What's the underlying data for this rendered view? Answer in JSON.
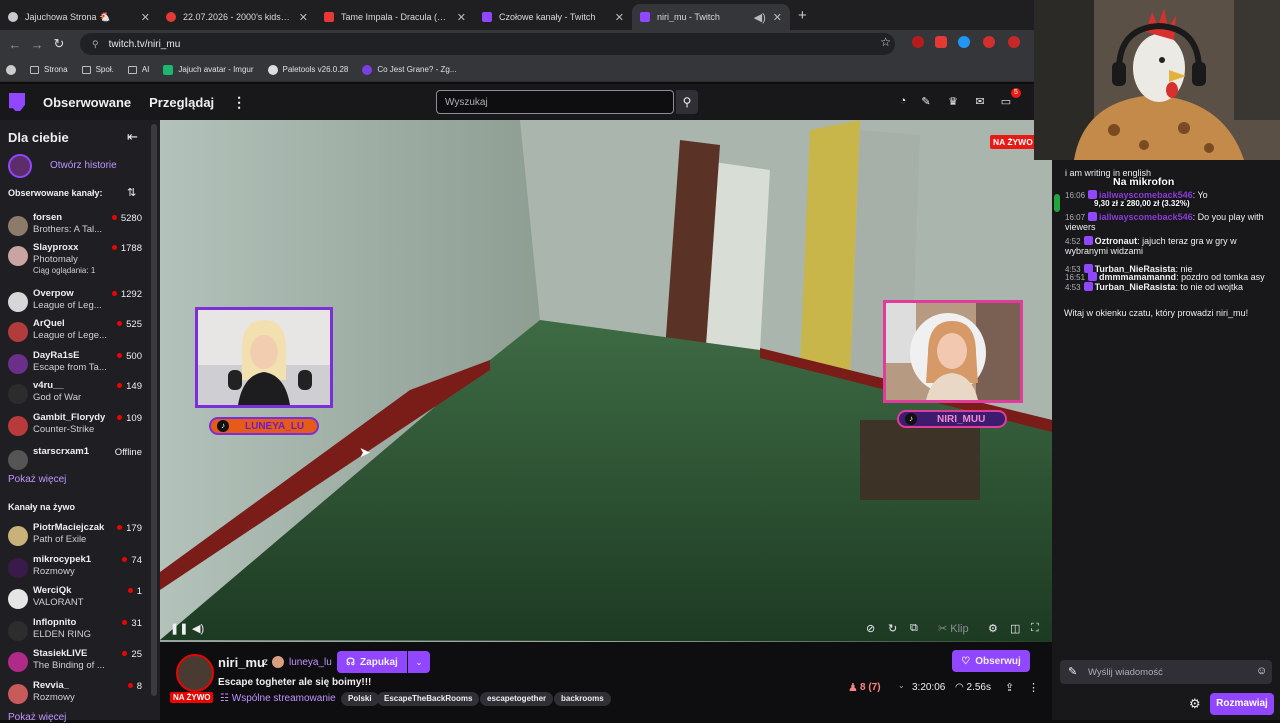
{
  "browser": {
    "tabs": [
      {
        "title": "Jajuchowa Strona 🐔",
        "color": "#c9c9cf"
      },
      {
        "title": "22.07.2026 - 2000's kids radio |",
        "color": "#e53935"
      },
      {
        "title": "Tame Impala - Dracula (Official",
        "color": "#e53935"
      },
      {
        "title": "Czołowe kanały - Twitch",
        "color": "#9147ff"
      },
      {
        "title": "niri_mu - Twitch",
        "color": "#9147ff"
      }
    ],
    "new_tab": "+",
    "url": "twitch.tv/niri_mu",
    "bookmarks": [
      "Strona",
      "Społ.",
      "AI",
      "Jajuch avatar - Imgur",
      "Paletools v26.0.28",
      "Co Jest Grane? - Zg..."
    ]
  },
  "topnav": {
    "following": "Obserwowane",
    "browse": "Przeglądaj",
    "search_placeholder": "Wyszukaj",
    "notif_count": "5"
  },
  "sidebar": {
    "heading": "Dla ciebie",
    "history_link": "Otwórz historie",
    "followed_heading": "Obserwowane kanały:",
    "followed": [
      {
        "name": "forsen",
        "game": "Brothers: A Tal...",
        "viewers": "5280",
        "color": "#8c7a6b"
      },
      {
        "name": "Slayproxx",
        "game": "Photomaly",
        "viewers": "1788",
        "extra": "Ciąg oglądania: 1",
        "color": "#c9a4a0"
      },
      {
        "name": "Overpow",
        "game": "League of Leg...",
        "viewers": "1292",
        "color": "#d7d7d7"
      },
      {
        "name": "ArQuel",
        "game": "League of Lege...",
        "viewers": "525",
        "color": "#b23b3b"
      },
      {
        "name": "DayRa1sE",
        "game": "Escape from Ta...",
        "viewers": "500",
        "color": "#6a2f8a"
      },
      {
        "name": "v4ru__",
        "game": "God of War",
        "viewers": "149",
        "color": "#2c2c2c"
      },
      {
        "name": "Gambit_Florydy",
        "game": "Counter-Strike",
        "viewers": "109",
        "color": "#b83a3a"
      },
      {
        "name": "starscrxam1",
        "game": "",
        "viewers": "Offline",
        "color": "#555"
      }
    ],
    "show_more": "Pokaż więcej",
    "live_heading": "Kanały na żywo",
    "live": [
      {
        "name": "PiotrMaciejczak",
        "game": "Path of Exile",
        "viewers": "179",
        "color": "#c9b27a"
      },
      {
        "name": "mikrocypek1",
        "game": "Rozmowy",
        "viewers": "74",
        "color": "#3a1a4a"
      },
      {
        "name": "WerciQk",
        "game": "VALORANT",
        "viewers": "1",
        "color": "#e5e5e5"
      },
      {
        "name": "Inflopnito",
        "game": "ELDEN RING",
        "viewers": "31",
        "color": "#2d2d2d"
      },
      {
        "name": "StasiekLIVE",
        "game": "The Binding of ...",
        "viewers": "25",
        "color": "#b02a8a"
      },
      {
        "name": "Revvia_",
        "game": "Rozmowy",
        "viewers": "8",
        "color": "#c95a5a"
      }
    ],
    "show_more_2": "Pokaż więcej"
  },
  "player": {
    "live_badge": "NA ŻYWO",
    "cam_left_tag": "LUNEYA_LU",
    "cam_right_tag": "NIRI_MUU",
    "clip_label": "Klip"
  },
  "stream": {
    "streamer": "niri_mu",
    "with_label": "z",
    "collab": "luneya_lu",
    "live_tag": "NA ŻYWO",
    "raid_button": "Zapukaj",
    "title": "Escape togheter ale się boimy!!!",
    "shared": "Wspólne streamowanie",
    "tags": [
      "Polski",
      "EscapeTheBackRooms",
      "escapetogether",
      "backrooms"
    ],
    "follow_button": "Obserwuj",
    "viewers": "8 (7)",
    "uptime": "3:20:06",
    "watch_count": "2.56s"
  },
  "chat": {
    "mic_title": "Na mikrofon",
    "mic_amount": "9,30 zł z 280,00 zł (3.32%)",
    "mic_progress": 0.0332,
    "lines": [
      {
        "text": "i am writing in english"
      },
      {
        "time": "16:06",
        "user": "iallwayscomeback546",
        "msg": ": Yo"
      },
      {
        "time": "16:07",
        "user": "iallwayscomeback546",
        "msg": ": Do you play with viewers"
      },
      {
        "time": "4:52",
        "user": "Oztronaut",
        "msg": ": jajuch teraz gra w gry w wybranymi widzami"
      },
      {
        "time": "4:53",
        "user": "Turban_NieRasista",
        "msg": ": nie"
      },
      {
        "time": "16:51",
        "user": "dmmmamamannd",
        "msg": ": pozdro od tomka asy"
      },
      {
        "time": "4:53",
        "user": "Turban_NieRasista",
        "msg": ": to nie od wojtka"
      }
    ],
    "welcome": "Witaj w okienku czatu, który prowadzi niri_mu!",
    "input_placeholder": "Wyślij wiadomość",
    "send_button": "Rozmawiaj"
  }
}
